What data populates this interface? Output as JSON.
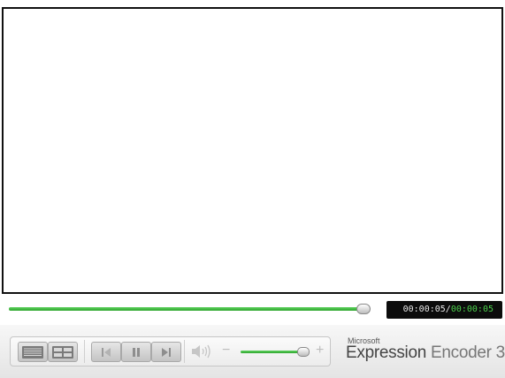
{
  "player": {
    "current_time": "00:00:05",
    "separator": "/",
    "total_time": "00:00:05",
    "seek_progress": 0.99,
    "volume_level": 0.92
  },
  "controls": {
    "volume_minus": "−",
    "volume_plus": "+"
  },
  "icons": {
    "playlist": "playlist-icon",
    "chapters": "chapters-grid-icon",
    "previous": "previous-icon",
    "pause": "pause-icon",
    "next": "next-icon",
    "volume": "speaker-icon"
  },
  "branding": {
    "company": "Microsoft",
    "product_bold": "Expression",
    "product_light": "Encoder 3"
  },
  "colors": {
    "accent_green": "#3cb83c",
    "time_bg": "#0c0c0c"
  }
}
